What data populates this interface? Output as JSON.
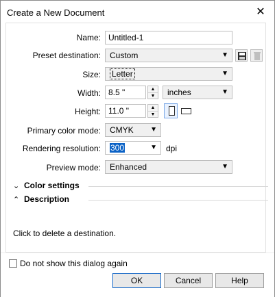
{
  "window": {
    "title": "Create a New Document",
    "close_icon": "close-icon"
  },
  "form": {
    "name_label": "Name:",
    "name_value": "Untitled-1",
    "preset_label": "Preset destination:",
    "preset_value": "Custom",
    "size_label": "Size:",
    "size_value": "Letter",
    "width_label": "Width:",
    "width_value": "8.5 \"",
    "height_label": "Height:",
    "height_value": "11.0 \"",
    "units_value": "inches",
    "color_mode_label": "Primary color mode:",
    "color_mode_value": "CMYK",
    "resolution_label": "Rendering resolution:",
    "resolution_value": "300",
    "dpi_label": "dpi",
    "preview_label": "Preview mode:",
    "preview_value": "Enhanced"
  },
  "sections": {
    "color_settings": "Color settings",
    "description": "Description"
  },
  "description_text": "Click to delete a destination.",
  "footer": {
    "dont_show_label": "Do not show this dialog again",
    "ok_label": "OK",
    "cancel_label": "Cancel",
    "help_label": "Help"
  },
  "icons": {
    "save": "save-icon",
    "delete": "trash-icon",
    "portrait": "portrait-icon",
    "landscape": "landscape-icon"
  }
}
